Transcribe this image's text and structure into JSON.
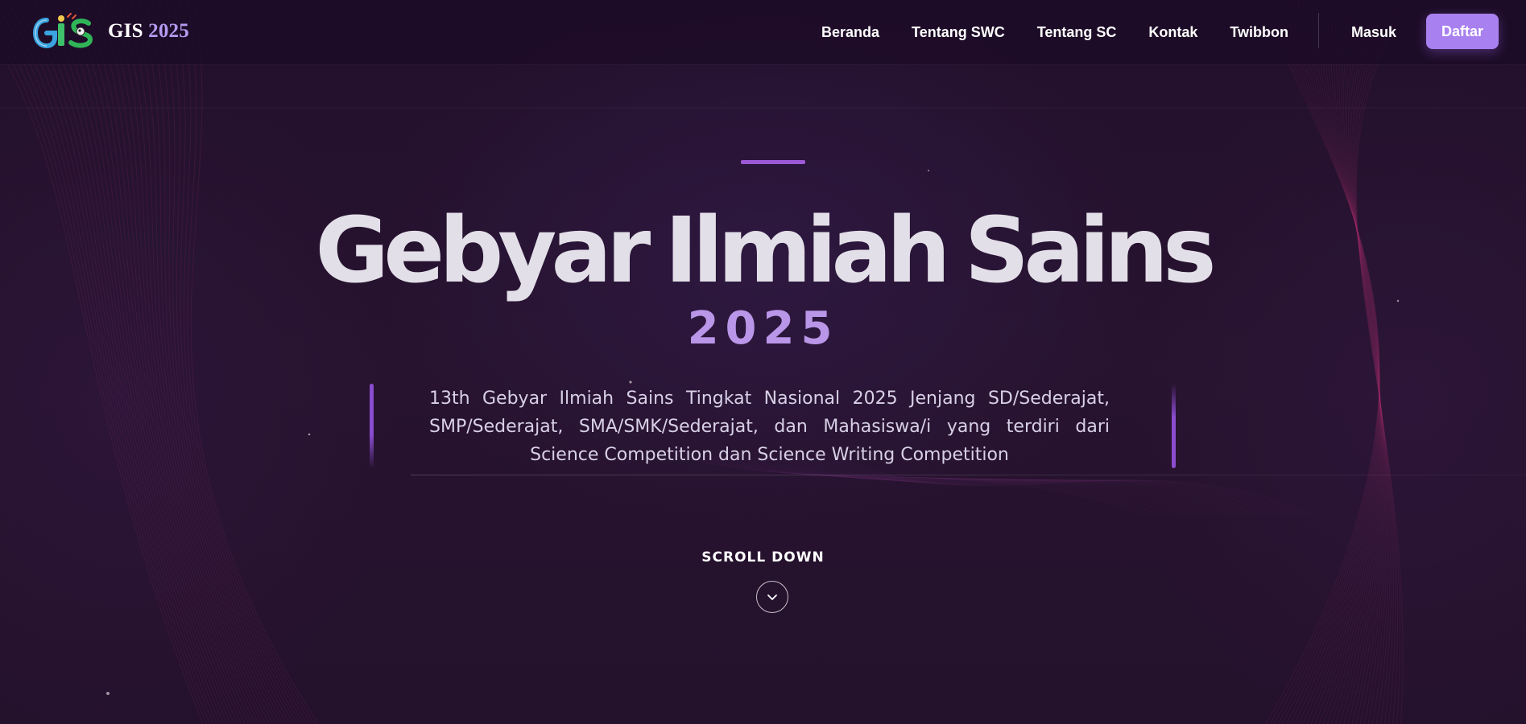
{
  "brand": {
    "name": "GIS",
    "year": "2025",
    "logo_icon": "gis-logo-icon"
  },
  "nav": {
    "items": [
      {
        "label": "Beranda"
      },
      {
        "label": "Tentang SWC"
      },
      {
        "label": "Tentang SC"
      },
      {
        "label": "Kontak"
      },
      {
        "label": "Twibbon"
      }
    ],
    "login_label": "Masuk",
    "register_label": "Daftar"
  },
  "hero": {
    "title": "Gebyar Ilmiah Sains",
    "year": "2025",
    "description": "13th Gebyar Ilmiah Sains Tingkat Nasional 2025 Jenjang SD/Sederajat, SMP/Sederajat, SMA/SMK/Sederajat, dan Mahasiswa/i yang terdiri dari Science Competition dan Science Writing Competition",
    "scroll_label": "SCROLL DOWN",
    "scroll_icon": "chevron-down-icon"
  },
  "colors": {
    "background": "#24122f",
    "accent": "#a880ef",
    "accent_dark": "#8b4cd0",
    "year_text": "#b996e8",
    "title_text": "#e3dfe8"
  }
}
